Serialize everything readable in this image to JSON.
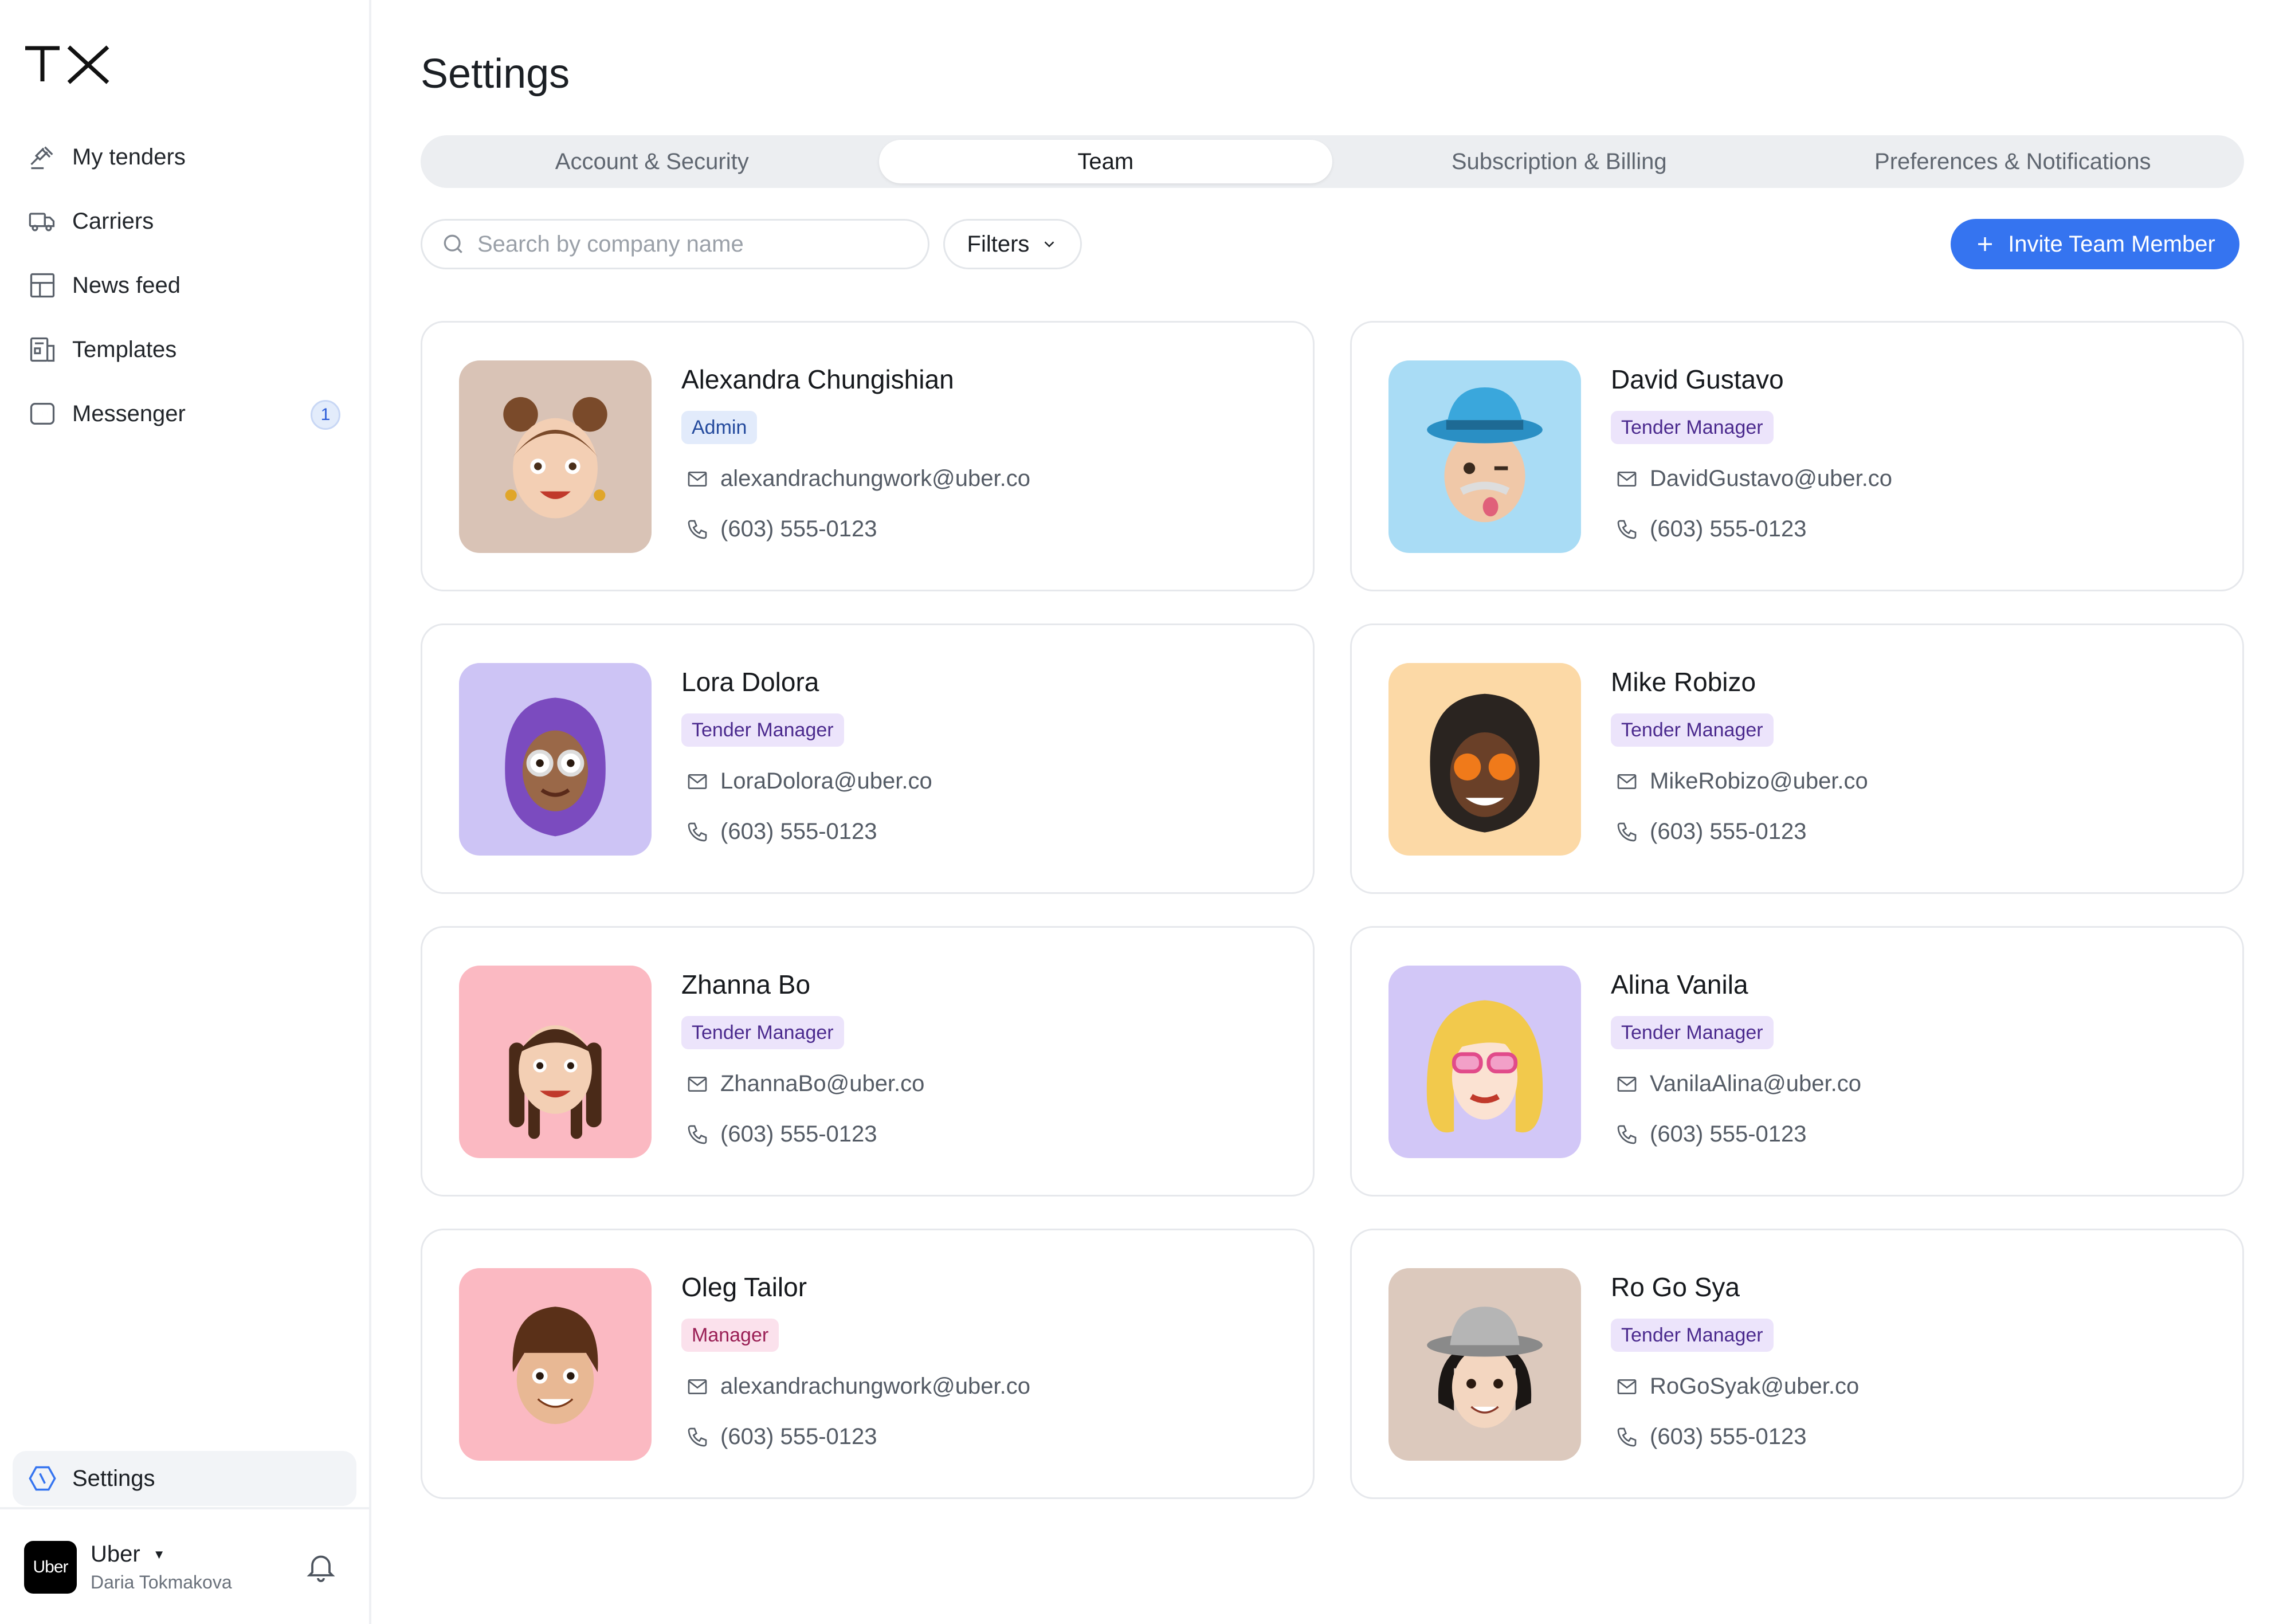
{
  "app": {
    "logo_text": "TX"
  },
  "sidebar": {
    "items": [
      {
        "label": "My tenders",
        "icon": "gavel-icon"
      },
      {
        "label": "Carriers",
        "icon": "truck-icon"
      },
      {
        "label": "News feed",
        "icon": "grid-icon"
      },
      {
        "label": "Templates",
        "icon": "template-icon"
      },
      {
        "label": "Messenger",
        "icon": "chat-icon",
        "badge": "1"
      }
    ],
    "settings_label": "Settings",
    "company": {
      "logo_text": "Uber",
      "name": "Uber",
      "user": "Daria Tokmakova"
    }
  },
  "page": {
    "title": "Settings"
  },
  "tabs": [
    {
      "label": "Account & Security",
      "active": false
    },
    {
      "label": "Team",
      "active": true
    },
    {
      "label": "Subscription & Billing",
      "active": false
    },
    {
      "label": "Preferences & Notifications",
      "active": false
    }
  ],
  "toolbar": {
    "search_placeholder": "Search by company name",
    "filters_label": "Filters",
    "invite_label": "Invite Team Member"
  },
  "colors": {
    "accent": "#3574f0",
    "admin_badge_bg": "#e2ebfb",
    "tender_badge_bg": "#ece4fb",
    "manager_badge_bg": "#fbe1ec"
  },
  "members": [
    {
      "name": "Alexandra Chungishian",
      "role": "Admin",
      "email": "alexandrachungwork@uber.co",
      "phone": "(603) 555-0123",
      "avatar_bg": "#d9c3b6"
    },
    {
      "name": "David Gustavo",
      "role": "Tender Manager",
      "email": "DavidGustavo@uber.co",
      "phone": "(603) 555-0123",
      "avatar_bg": "#a9dcf5"
    },
    {
      "name": "Lora Dolora",
      "role": "Tender Manager",
      "email": "LoraDolora@uber.co",
      "phone": "(603) 555-0123",
      "avatar_bg": "#cdc4f5"
    },
    {
      "name": "Mike Robizo",
      "role": "Tender Manager",
      "email": "MikeRobizo@uber.co",
      "phone": "(603) 555-0123",
      "avatar_bg": "#fcd9a6"
    },
    {
      "name": "Zhanna Bo",
      "role": "Tender Manager",
      "email": "ZhannaBo@uber.co",
      "phone": "(603) 555-0123",
      "avatar_bg": "#fbb9c2"
    },
    {
      "name": "Alina Vanila",
      "role": "Tender Manager",
      "email": "VanilaAlina@uber.co",
      "phone": "(603) 555-0123",
      "avatar_bg": "#d2c7f7"
    },
    {
      "name": "Oleg Tailor",
      "role": "Manager",
      "email": "alexandrachungwork@uber.co",
      "phone": "(603) 555-0123",
      "avatar_bg": "#fbb9c2"
    },
    {
      "name": "Ro Go Sya",
      "role": "Tender Manager",
      "email": "RoGoSyak@uber.co",
      "phone": "(603) 555-0123",
      "avatar_bg": "#dcc9bd"
    }
  ]
}
